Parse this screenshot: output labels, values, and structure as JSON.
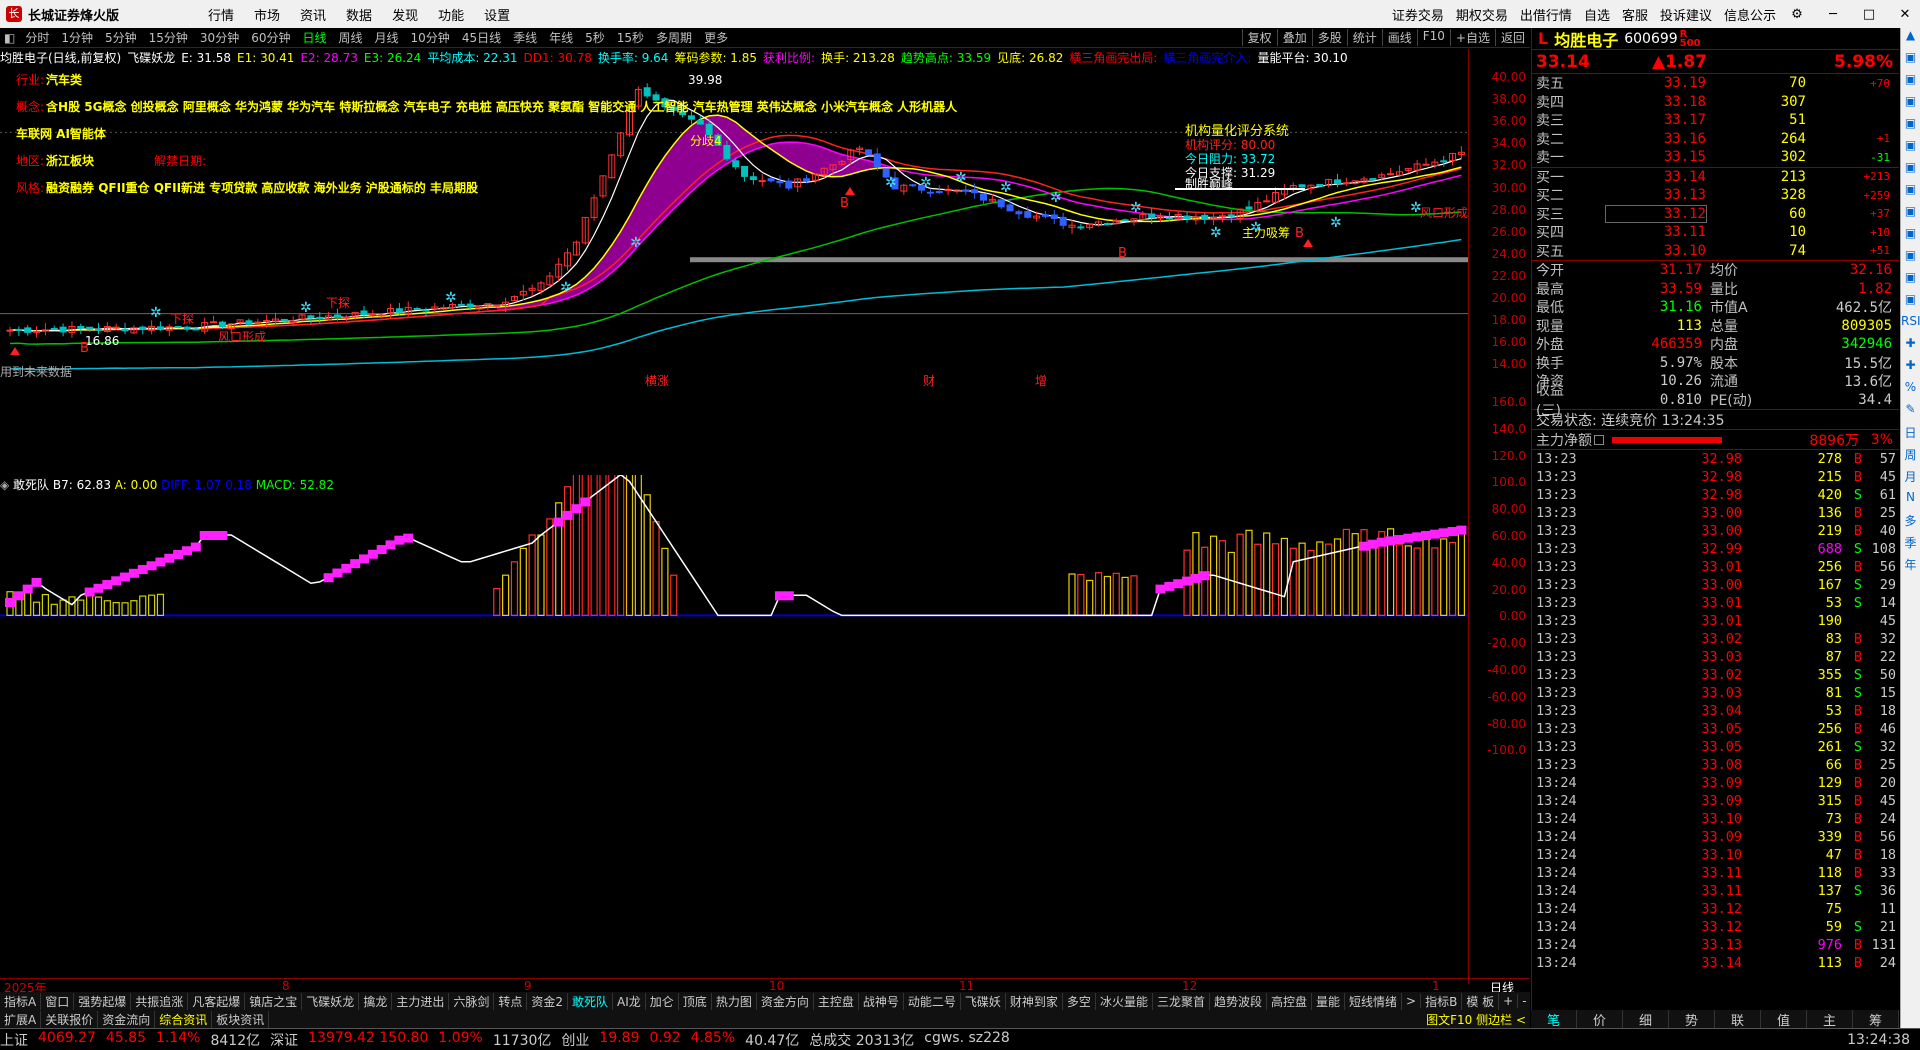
{
  "app": {
    "name": "长城证券烽火版",
    "menus": [
      "行情",
      "市场",
      "资讯",
      "数据",
      "发现",
      "功能",
      "设置"
    ],
    "right_links": [
      "证券交易",
      "期权交易",
      "出借行情",
      "自选",
      "客服",
      "投诉建议",
      "信息公示"
    ]
  },
  "toolbar": {
    "periods": [
      "分时",
      "1分钟",
      "5分钟",
      "15分钟",
      "30分钟",
      "60分钟",
      "日线",
      "周线",
      "月线",
      "10分钟",
      "45日线",
      "季线",
      "年线",
      "5秒",
      "15秒",
      "多周期",
      "更多"
    ],
    "active": "日线",
    "right": [
      "复权",
      "叠加",
      "多股",
      "统计",
      "画线",
      "F10",
      "+自选",
      "返回"
    ]
  },
  "indicator_bar": [
    {
      "t": "均胜电子(日线,前复权)",
      "c": "#ffffff"
    },
    {
      "t": "飞碟妖龙",
      "c": "#ffffff"
    },
    {
      "t": "E: 31.58",
      "c": "#ffffff"
    },
    {
      "t": "E1: 30.41",
      "c": "#ffff00"
    },
    {
      "t": "E2: 28.73",
      "c": "#ff00ff"
    },
    {
      "t": "E3: 26.24",
      "c": "#00ff00"
    },
    {
      "t": "平均成本: 22.31",
      "c": "#00ffff"
    },
    {
      "t": "DD1: 30.78",
      "c": "#ff0000"
    },
    {
      "t": "换手率: 9.64",
      "c": "#00ffff"
    },
    {
      "t": "筹码参数: 1.85",
      "c": "#ffff00"
    },
    {
      "t": "获利比例:",
      "c": "#ff00ff"
    },
    {
      "t": "换手: 213.28",
      "c": "#ffff00"
    },
    {
      "t": "趋势高点: 33.59",
      "c": "#00ff00"
    },
    {
      "t": "见底: 26.82",
      "c": "#ffff00"
    },
    {
      "t": "横三角画完出局:",
      "c": "#ff0000"
    },
    {
      "t": "横三角画完介入:",
      "c": "#0000ff"
    },
    {
      "t": "量能平台: 30.10",
      "c": "#ffffff"
    }
  ],
  "info": {
    "industry": {
      "k": "行业:",
      "v": "汽车类"
    },
    "concept": {
      "k": "概念:",
      "v": "含H股 5G概念 创投概念 阿里概念 华为鸿蒙 华为汽车 特斯拉概念 汽车电子 充电桩 高压快充 聚氨酯 智能交通 人工智能 汽车热管理 英伟达概念 小米汽车概念 人形机器人 车联网 AI智能体"
    },
    "region": {
      "k": "地区:",
      "v": "浙江板块"
    },
    "unlock": {
      "k": "解禁日期:",
      "v": ""
    },
    "style": {
      "k": "风格:",
      "v": "融资融券 QFII重仓 QFII新进 专项贷款 高应收款 海外业务 沪股通标的 丰局期股"
    }
  },
  "annotations": {
    "jg_title": "机构量化评分系统",
    "jg_score": "机构评分: 80.00",
    "jg_res": "今日阻力: 33.72",
    "jg_sup": "今日支撑: 31.29",
    "stop": "制胜巅峰",
    "zhuli": "主力吸筹",
    "fenkou": "风口形成",
    "fenkou2": "风口形成",
    "low": "16.86",
    "high": "39.98",
    "dragon": "分歧4",
    "future": "用到未来数据",
    "jiangshu": "下探",
    "jiangshu2": "下探",
    "marker_zhang": "横涨",
    "marker_cai": "财",
    "marker_zeng": "增"
  },
  "y_main": [
    "40.00",
    "38.00",
    "36.00",
    "34.00",
    "32.00",
    "30.00",
    "28.00",
    "26.00",
    "24.00",
    "22.00",
    "20.00",
    "18.00",
    "16.00",
    "14.00"
  ],
  "y_sub": [
    "160.0",
    "140.0",
    "120.0",
    "100.0",
    "80.00",
    "60.00",
    "40.00",
    "20.00",
    "0.00",
    "-20.00",
    "-40.00",
    "-60.00",
    "-80.00",
    "-100.0"
  ],
  "sub_legend": [
    {
      "t": "敢死队",
      "c": "#ffffff"
    },
    {
      "t": "B7: 62.83",
      "c": "#ffffff"
    },
    {
      "t": "A: 0.00",
      "c": "#ffff00"
    },
    {
      "t": "DIFF: 1.07",
      "c": "#0000ff"
    },
    {
      "t": "0.18",
      "c": "#0000ff"
    },
    {
      "t": "MACD: 52.82",
      "c": "#00ff00"
    }
  ],
  "x_axis": [
    "2025年",
    "8",
    "9",
    "10",
    "11",
    "12",
    "1"
  ],
  "x_right": "日线",
  "tabs1": [
    "指标A",
    "窗口",
    "强势起爆",
    "共振追涨",
    "凡客起爆",
    "镇店之宝",
    "飞碟妖龙",
    "擒龙",
    "主力进出",
    "六脉剑",
    "转点",
    "资金2",
    "敢死队",
    "AI龙",
    "加仑",
    "顶底",
    "热力图",
    "资金方向",
    "主控盘",
    "战神号",
    "动能二号",
    "飞碟妖",
    "财神到家",
    "多空",
    "冰火量能",
    "三龙聚首",
    "趋势波段",
    "高控盘",
    "量能",
    "短线情绪",
    ">",
    "指标B",
    "模 板",
    "+",
    "-"
  ],
  "tabs1_active": "敢死队",
  "tabs2": [
    "扩展A",
    "关联报价",
    "资金流向",
    "综合资讯",
    "板块资讯"
  ],
  "tabs2_active": "综合资讯",
  "tabs2_right": "图文F10 侧边栏 <",
  "status": [
    {
      "t": "上证",
      "c": "#ccc"
    },
    {
      "t": "4069.27",
      "c": "#f00"
    },
    {
      "t": "45.85",
      "c": "#f00"
    },
    {
      "t": "1.14%",
      "c": "#f00"
    },
    {
      "t": "8412亿",
      "c": "#ccc"
    },
    {
      "t": "深证",
      "c": "#ccc"
    },
    {
      "t": "13979.42 150.80",
      "c": "#f00"
    },
    {
      "t": "1.09%",
      "c": "#f00"
    },
    {
      "t": "11730亿",
      "c": "#ccc"
    },
    {
      "t": "创业",
      "c": "#ccc"
    },
    {
      "t": "19.89",
      "c": "#f00"
    },
    {
      "t": "0.92",
      "c": "#f00"
    },
    {
      "t": "4.85%",
      "c": "#f00"
    },
    {
      "t": "40.47亿",
      "c": "#ccc"
    },
    {
      "t": "总成交 20313亿",
      "c": "#ccc"
    },
    {
      "t": "cgws. sz228",
      "c": "#ccc"
    }
  ],
  "clock": "13:24:38",
  "stock": {
    "name": "均胜电子",
    "code": "600699",
    "tag": "R",
    "tag2": "500",
    "price": "33.14",
    "change": "▲1.87",
    "pct": "5.98%"
  },
  "orderbook": {
    "asks": [
      {
        "l": "卖五",
        "p": "33.19",
        "v": "70",
        "c": "+70"
      },
      {
        "l": "卖四",
        "p": "33.18",
        "v": "307",
        "c": ""
      },
      {
        "l": "卖三",
        "p": "33.17",
        "v": "51",
        "c": ""
      },
      {
        "l": "卖二",
        "p": "33.16",
        "v": "264",
        "c": "+1"
      },
      {
        "l": "卖一",
        "p": "33.15",
        "v": "302",
        "c": "-31"
      }
    ],
    "bids": [
      {
        "l": "买一",
        "p": "33.14",
        "v": "213",
        "c": "+213"
      },
      {
        "l": "买二",
        "p": "33.13",
        "v": "328",
        "c": "+259"
      },
      {
        "l": "买三",
        "p": "33.12",
        "v": "60",
        "c": "+37"
      },
      {
        "l": "买四",
        "p": "33.11",
        "v": "10",
        "c": "+10"
      },
      {
        "l": "买五",
        "p": "33.10",
        "v": "74",
        "c": "+51"
      }
    ]
  },
  "stats": [
    {
      "l1": "今开",
      "v1": "31.17",
      "c1": "#f00",
      "l2": "均价",
      "v2": "32.16",
      "c2": "#f00"
    },
    {
      "l1": "最高",
      "v1": "33.59",
      "c1": "#f00",
      "l2": "量比",
      "v2": "1.82",
      "c2": "#f00"
    },
    {
      "l1": "最低",
      "v1": "31.16",
      "c1": "#0f0",
      "l2": "市值A",
      "v2": "462.5亿",
      "c2": "#ccc"
    },
    {
      "l1": "现量",
      "v1": "113",
      "c1": "#ff0",
      "l2": "总量",
      "v2": "809305",
      "c2": "#ff0"
    },
    {
      "l1": "外盘",
      "v1": "466359",
      "c1": "#f00",
      "l2": "内盘",
      "v2": "342946",
      "c2": "#0f0"
    },
    {
      "l1": "换手",
      "v1": "5.97%",
      "c1": "#ccc",
      "l2": "股本",
      "v2": "15.5亿",
      "c2": "#ccc"
    },
    {
      "l1": "净资",
      "v1": "10.26",
      "c1": "#ccc",
      "l2": "流通",
      "v2": "13.6亿",
      "c2": "#ccc"
    },
    {
      "l1": "收益(三)",
      "v1": "0.810",
      "c1": "#ccc",
      "l2": "PE(动)",
      "v2": "34.4",
      "c2": "#ccc"
    }
  ],
  "trade_status": "交易状态: 连续竞价 13:24:35",
  "main_flow": {
    "label": "主力净额",
    "value": "8896万",
    "pct": "3%"
  },
  "ticks": [
    [
      "13:23",
      "32.98",
      "278",
      "B",
      "57"
    ],
    [
      "13:23",
      "32.98",
      "215",
      "B",
      "45"
    ],
    [
      "13:23",
      "32.98",
      "420",
      "S",
      "61"
    ],
    [
      "13:23",
      "33.00",
      "136",
      "B",
      "25"
    ],
    [
      "13:23",
      "33.00",
      "219",
      "B",
      "40"
    ],
    [
      "13:23",
      "32.99",
      "688",
      "S",
      "108"
    ],
    [
      "13:23",
      "33.01",
      "256",
      "B",
      "56"
    ],
    [
      "13:23",
      "33.00",
      "167",
      "S",
      "29"
    ],
    [
      "13:23",
      "33.01",
      "53",
      "S",
      "14"
    ],
    [
      "13:23",
      "33.01",
      "190",
      "",
      "45"
    ],
    [
      "13:23",
      "33.02",
      "83",
      "B",
      "32"
    ],
    [
      "13:23",
      "33.03",
      "87",
      "B",
      "22"
    ],
    [
      "13:23",
      "33.02",
      "355",
      "S",
      "50"
    ],
    [
      "13:23",
      "33.03",
      "81",
      "S",
      "15"
    ],
    [
      "13:23",
      "33.04",
      "53",
      "B",
      "18"
    ],
    [
      "13:23",
      "33.05",
      "256",
      "B",
      "46"
    ],
    [
      "13:23",
      "33.05",
      "261",
      "S",
      "32"
    ],
    [
      "13:23",
      "33.08",
      "66",
      "B",
      "25"
    ],
    [
      "13:24",
      "33.09",
      "129",
      "B",
      "20"
    ],
    [
      "13:24",
      "33.09",
      "315",
      "B",
      "45"
    ],
    [
      "13:24",
      "33.10",
      "73",
      "B",
      "24"
    ],
    [
      "13:24",
      "33.09",
      "339",
      "B",
      "56"
    ],
    [
      "13:24",
      "33.10",
      "47",
      "B",
      "18"
    ],
    [
      "13:24",
      "33.11",
      "118",
      "B",
      "33"
    ],
    [
      "13:24",
      "33.11",
      "137",
      "S",
      "36"
    ],
    [
      "13:24",
      "33.12",
      "75",
      "",
      "11"
    ],
    [
      "13:24",
      "33.12",
      "59",
      "S",
      "21"
    ],
    [
      "13:24",
      "33.13",
      "976",
      "B",
      "131"
    ],
    [
      "13:24",
      "33.14",
      "113",
      "B",
      "24"
    ]
  ],
  "rp_tabs": [
    "笔",
    "价",
    "细",
    "势",
    "联",
    "值",
    "主",
    "筹"
  ],
  "rp_active": "笔",
  "sidebar": [
    "▲",
    "▣",
    "▣",
    "▣",
    "▣",
    "▣",
    "▣",
    "▣",
    "▣",
    "▣",
    "▣",
    "▣",
    "▣",
    "RSI",
    "✚",
    "✚",
    "%",
    "✎",
    "日",
    "周",
    "月",
    "N",
    "多",
    "季",
    "年"
  ]
}
